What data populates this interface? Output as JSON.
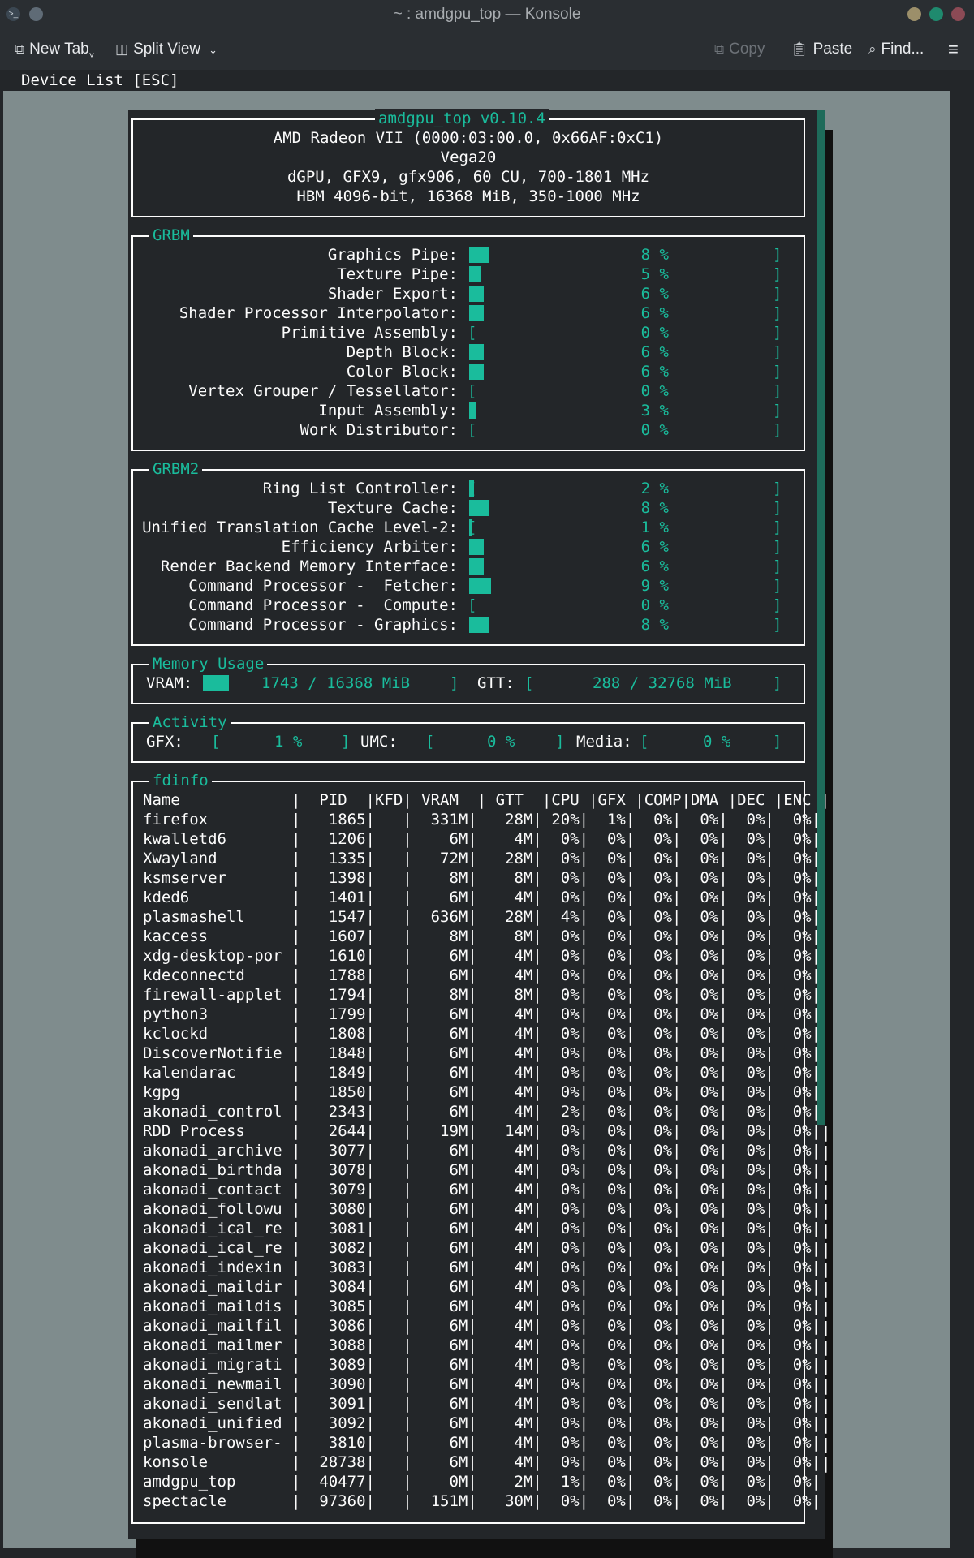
{
  "window": {
    "title": "~ : amdgpu_top — Konsole"
  },
  "toolbar": {
    "new_tab": "New Tab",
    "split_view": "Split View",
    "copy": "Copy",
    "paste": "Paste",
    "find": "Find..."
  },
  "device_list": "Device List [ESC]",
  "device": {
    "title": "amdgpu_top v0.10.4",
    "line1": "AMD Radeon VII (0000:03:00.0, 0x66AF:0xC1)",
    "line2": "Vega20",
    "line3": "dGPU, GFX9, gfx906, 60 CU, 700-1801 MHz",
    "line4": "HBM 4096-bit, 16368 MiB, 350-1000 MHz"
  },
  "grbm": {
    "title": "GRBM",
    "items": [
      {
        "label": "Graphics Pipe:",
        "pct": "8 %",
        "value": 8
      },
      {
        "label": "Texture Pipe:",
        "pct": "5 %",
        "value": 5
      },
      {
        "label": "Shader Export:",
        "pct": "6 %",
        "value": 6
      },
      {
        "label": "Shader Processor Interpolator:",
        "pct": "6 %",
        "value": 6
      },
      {
        "label": "Primitive Assembly:",
        "pct": "0 %",
        "value": 0
      },
      {
        "label": "Depth Block:",
        "pct": "6 %",
        "value": 6
      },
      {
        "label": "Color Block:",
        "pct": "6 %",
        "value": 6
      },
      {
        "label": "Vertex Grouper / Tessellator:",
        "pct": "0 %",
        "value": 0
      },
      {
        "label": "Input Assembly:",
        "pct": "3 %",
        "value": 3
      },
      {
        "label": "Work Distributor:",
        "pct": "0 %",
        "value": 0
      }
    ]
  },
  "grbm2": {
    "title": "GRBM2",
    "items": [
      {
        "label": "Ring List Controller:",
        "pct": "2 %",
        "value": 2
      },
      {
        "label": "Texture Cache:",
        "pct": "8 %",
        "value": 8
      },
      {
        "label": "Unified Translation Cache Level-2:",
        "pct": "1 %",
        "value": 1
      },
      {
        "label": "Efficiency Arbiter:",
        "pct": "6 %",
        "value": 6
      },
      {
        "label": "Render Backend Memory Interface:",
        "pct": "6 %",
        "value": 6
      },
      {
        "label": "Command Processor -  Fetcher:",
        "pct": "9 %",
        "value": 9
      },
      {
        "label": "Command Processor -  Compute:",
        "pct": "0 %",
        "value": 0
      },
      {
        "label": "Command Processor - Graphics:",
        "pct": "8 %",
        "value": 8
      }
    ]
  },
  "memory": {
    "title": "Memory Usage",
    "vram_label": "VRAM:",
    "vram_value": "1743 / 16368 MiB",
    "vram_fraction": 0.106,
    "gtt_label": "GTT:",
    "gtt_value": "288 / 32768 MiB",
    "gtt_fraction": 0.009
  },
  "activity": {
    "title": "Activity",
    "gfx_label": "GFX:",
    "gfx_value": "1 %",
    "umc_label": "UMC:",
    "umc_value": "0 %",
    "media_label": "Media:",
    "media_value": "0 %"
  },
  "fdinfo": {
    "title": "fdinfo",
    "header": "Name            |  PID  |KFD| VRAM  | GTT  |CPU |GFX |COMP|DMA |DEC |ENC |",
    "rows": [
      "firefox         |   1865|   |  331M|   28M| 20%|  1%|  0%|  0%|  0%|  0%|",
      "kwalletd6       |   1206|   |    6M|    4M|  0%|  0%|  0%|  0%|  0%|  0%|",
      "Xwayland        |   1335|   |   72M|   28M|  0%|  0%|  0%|  0%|  0%|  0%|",
      "ksmserver       |   1398|   |    8M|    8M|  0%|  0%|  0%|  0%|  0%|  0%|",
      "kded6           |   1401|   |    6M|    4M|  0%|  0%|  0%|  0%|  0%|  0%|",
      "plasmashell     |   1547|   |  636M|   28M|  4%|  0%|  0%|  0%|  0%|  0%|",
      "kaccess         |   1607|   |    8M|    8M|  0%|  0%|  0%|  0%|  0%|  0%|",
      "xdg-desktop-por |   1610|   |    6M|    4M|  0%|  0%|  0%|  0%|  0%|  0%|",
      "kdeconnectd     |   1788|   |    6M|    4M|  0%|  0%|  0%|  0%|  0%|  0%|",
      "firewall-applet |   1794|   |    8M|    8M|  0%|  0%|  0%|  0%|  0%|  0%|",
      "python3         |   1799|   |    6M|    4M|  0%|  0%|  0%|  0%|  0%|  0%|",
      "kclockd         |   1808|   |    6M|    4M|  0%|  0%|  0%|  0%|  0%|  0%|",
      "DiscoverNotifie |   1848|   |    6M|    4M|  0%|  0%|  0%|  0%|  0%|  0%|",
      "kalendarac      |   1849|   |    6M|    4M|  0%|  0%|  0%|  0%|  0%|  0%|",
      "kgpg            |   1850|   |    6M|    4M|  0%|  0%|  0%|  0%|  0%|  0%|",
      "akonadi_control |   2343|   |    6M|    4M|  2%|  0%|  0%|  0%|  0%|  0%|",
      "RDD Process     |   2644|   |   19M|   14M|  0%|  0%|  0%|  0%|  0%|  0%|",
      "akonadi_archive |   3077|   |    6M|    4M|  0%|  0%|  0%|  0%|  0%|  0%|",
      "akonadi_birthda |   3078|   |    6M|    4M|  0%|  0%|  0%|  0%|  0%|  0%|",
      "akonadi_contact |   3079|   |    6M|    4M|  0%|  0%|  0%|  0%|  0%|  0%|",
      "akonadi_followu |   3080|   |    6M|    4M|  0%|  0%|  0%|  0%|  0%|  0%|",
      "akonadi_ical_re |   3081|   |    6M|    4M|  0%|  0%|  0%|  0%|  0%|  0%|",
      "akonadi_ical_re |   3082|   |    6M|    4M|  0%|  0%|  0%|  0%|  0%|  0%|",
      "akonadi_indexin |   3083|   |    6M|    4M|  0%|  0%|  0%|  0%|  0%|  0%|",
      "akonadi_maildir |   3084|   |    6M|    4M|  0%|  0%|  0%|  0%|  0%|  0%|",
      "akonadi_maildis |   3085|   |    6M|    4M|  0%|  0%|  0%|  0%|  0%|  0%|",
      "akonadi_mailfil |   3086|   |    6M|    4M|  0%|  0%|  0%|  0%|  0%|  0%|",
      "akonadi_mailmer |   3088|   |    6M|    4M|  0%|  0%|  0%|  0%|  0%|  0%|",
      "akonadi_migrati |   3089|   |    6M|    4M|  0%|  0%|  0%|  0%|  0%|  0%|",
      "akonadi_newmail |   3090|   |    6M|    4M|  0%|  0%|  0%|  0%|  0%|  0%|",
      "akonadi_sendlat |   3091|   |    6M|    4M|  0%|  0%|  0%|  0%|  0%|  0%|",
      "akonadi_unified |   3092|   |    6M|    4M|  0%|  0%|  0%|  0%|  0%|  0%|",
      "plasma-browser- |   3810|   |    6M|    4M|  0%|  0%|  0%|  0%|  0%|  0%|",
      "konsole         |  28738|   |    6M|    4M|  0%|  0%|  0%|  0%|  0%|  0%|",
      "amdgpu_top      |  40477|   |    0M|    2M|  1%|  0%|  0%|  0%|  0%|  0%|",
      "spectacle       |  97360|   |  151M|   30M|  0%|  0%|  0%|  0%|  0%|  0%|"
    ]
  }
}
